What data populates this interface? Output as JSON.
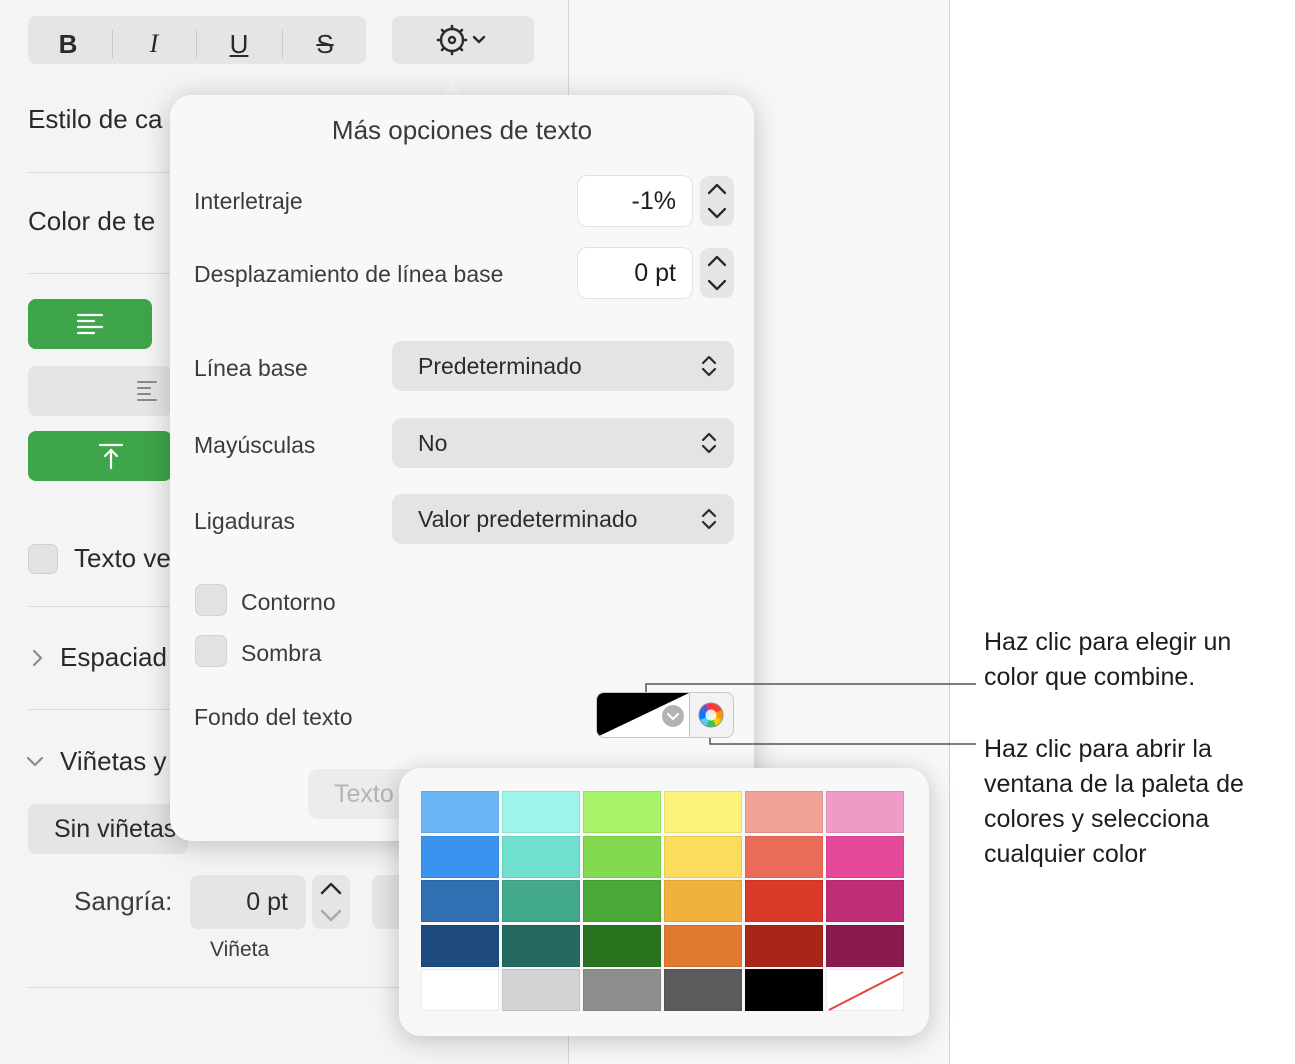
{
  "toolbar": {
    "bold": "B",
    "italic": "I",
    "underline": "U",
    "strikethrough": "S"
  },
  "sidebar": {
    "char_style_label": "Estilo de ca",
    "text_color_label": "Color de te",
    "vertical_text_label": "Texto ve",
    "spacing_label": "Espaciad",
    "bullets_label": "Viñetas y",
    "bullets_value": "Sin viñetas",
    "indent_label": "Sangría:",
    "indent_value": "0 pt",
    "bullet_caption": "Viñeta",
    "text_button": "Texto"
  },
  "popover": {
    "title": "Más opciones de texto",
    "tracking_label": "Interletraje",
    "tracking_value": "-1%",
    "baseline_shift_label": "Desplazamiento de línea base",
    "baseline_shift_value": "0 pt",
    "baseline_label": "Línea base",
    "baseline_value": "Predeterminado",
    "caps_label": "Mayúsculas",
    "caps_value": "No",
    "ligatures_label": "Ligaduras",
    "ligatures_value": "Valor predeterminado",
    "outline_label": "Contorno",
    "shadow_label": "Sombra",
    "text_bg_label": "Fondo del texto"
  },
  "palette": {
    "rows": [
      [
        "#6db6f6",
        "#9cf5e8",
        "#a7f36a",
        "#fdf27a",
        "#f1a196",
        "#f09ac8"
      ],
      [
        "#3a93ee",
        "#6fe0cd",
        "#83d94f",
        "#fcdc5c",
        "#ea6c58",
        "#e7499a"
      ],
      [
        "#2f6fb2",
        "#43a98c",
        "#4aa836",
        "#f1b23d",
        "#d93a2a",
        "#be2e77"
      ],
      [
        "#1d4b7d",
        "#246a62",
        "#2a7420",
        "#e27930",
        "#a72617",
        "#8a1b51"
      ],
      [
        "#ffffff",
        "#d4d4d4",
        "#8e8e8e",
        "#5b5b5b",
        "#000000",
        "none"
      ]
    ]
  },
  "callouts": {
    "match_color_1": "Haz clic para elegir un",
    "match_color_2": "color que combine.",
    "palette_1": "Haz clic para abrir la",
    "palette_2": "ventana de la paleta de",
    "palette_3": "colores y selecciona",
    "palette_4": "cualquier color"
  },
  "colors": {
    "accent_green": "#3ea54a",
    "callout_line": "#555555"
  }
}
